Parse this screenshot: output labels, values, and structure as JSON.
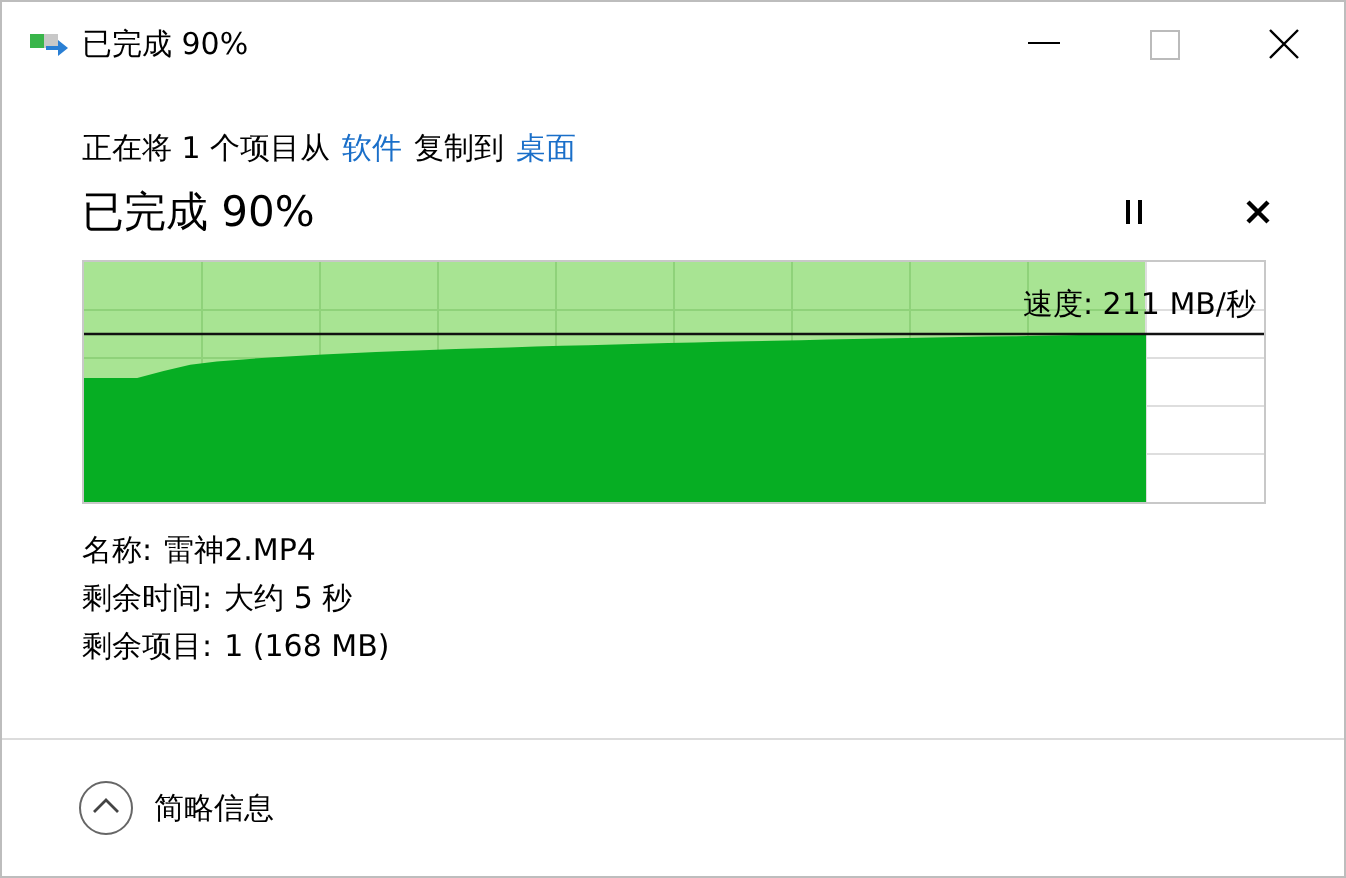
{
  "window": {
    "title": "已完成 90%"
  },
  "copy_line": [
    {
      "text": "正在将 1 个项目从",
      "link": false
    },
    {
      "text": "软件",
      "link": true
    },
    {
      "text": "复制到",
      "link": false
    },
    {
      "text": "桌面",
      "link": true
    }
  ],
  "heading": "已完成 90%",
  "progress": {
    "level": 0.9,
    "speed": "速度: 211 MB/秒"
  },
  "details": [
    {
      "label": "名称:",
      "value": "雷神2.MP4"
    },
    {
      "label": "剩余时间:",
      "value": "大约 5 秒"
    },
    {
      "label": "剩余项目:",
      "value": "1 (168 MB)"
    }
  ],
  "footer": {
    "toggle": "简略信息",
    "expanded": true
  }
}
